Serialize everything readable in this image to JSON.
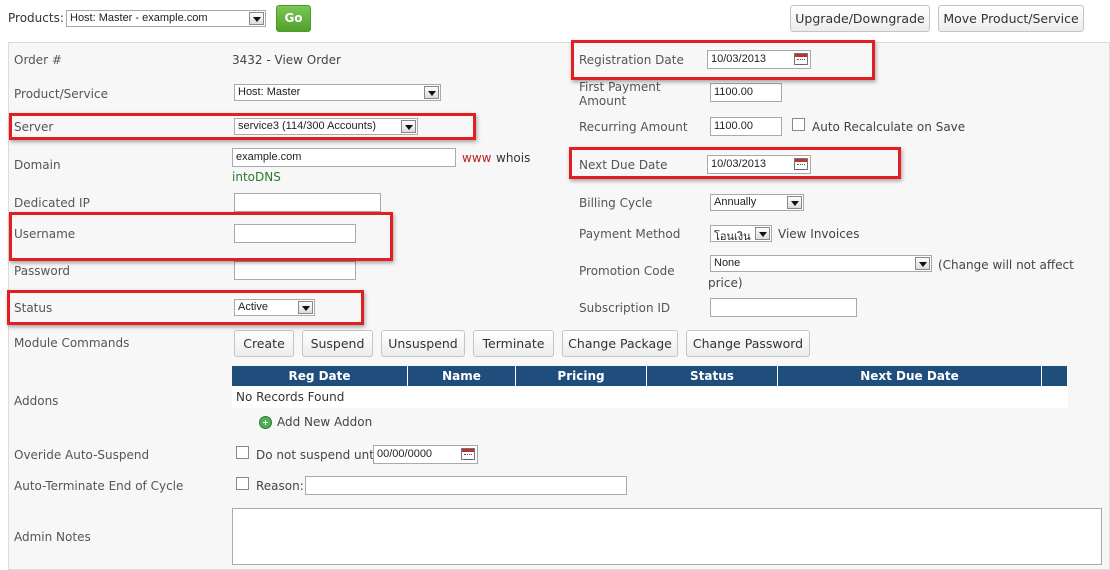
{
  "topbar": {
    "products_label": "Products:",
    "products_value": "Host: Master - example.com",
    "go_label": "Go",
    "upgrade_label": "Upgrade/Downgrade",
    "move_label": "Move Product/Service"
  },
  "left": {
    "order_label": "Order #",
    "order_value": "3432 - View Order",
    "product_label": "Product/Service",
    "product_value": "Host: Master",
    "server_label": "Server",
    "server_value": "service3 (114/300 Accounts)",
    "domain_label": "Domain",
    "domain_value": "example.com",
    "domain_link_www": "www",
    "domain_link_whois": "whois",
    "domain_link_intodns": "intoDNS",
    "dedicated_ip_label": "Dedicated IP",
    "dedicated_ip_value": "",
    "username_label": "Username",
    "username_value": "",
    "password_label": "Password",
    "password_value": "",
    "status_label": "Status",
    "status_value": "Active"
  },
  "right": {
    "reg_date_label": "Registration Date",
    "reg_date_value": "10/03/2013",
    "first_payment_label": "First Payment Amount",
    "first_payment_value": "1100.00",
    "recurring_label": "Recurring Amount",
    "recurring_value": "1100.00",
    "auto_recalc_label": "Auto Recalculate on Save",
    "next_due_label": "Next Due Date",
    "next_due_value": "10/03/2013",
    "billing_cycle_label": "Billing Cycle",
    "billing_cycle_value": "Annually",
    "payment_method_label": "Payment Method",
    "payment_method_value": "โอนเงิน",
    "view_invoices_label": "View Invoices",
    "promo_label": "Promotion Code",
    "promo_value": "None",
    "promo_note": "(Change will not affect price)",
    "subscription_label": "Subscription ID",
    "subscription_value": ""
  },
  "module": {
    "label": "Module Commands",
    "buttons": [
      "Create",
      "Suspend",
      "Unsuspend",
      "Terminate",
      "Change Package",
      "Change Password"
    ]
  },
  "addons": {
    "label": "Addons",
    "columns": [
      "Reg Date",
      "Name",
      "Pricing",
      "Status",
      "Next Due Date"
    ],
    "empty_text": "No Records Found",
    "add_label": "Add New Addon"
  },
  "override": {
    "label": "Overide Auto-Suspend",
    "checkbox_label": "Do not suspend until",
    "date_value": "00/00/0000"
  },
  "autoterminate": {
    "label": "Auto-Terminate End of Cycle",
    "reason_label": "Reason:",
    "reason_value": ""
  },
  "notes": {
    "label": "Admin Notes",
    "value": ""
  },
  "colors": {
    "highlight": "#e02020",
    "table_header": "#1f4e7d",
    "go_button": "#4fa12b"
  }
}
